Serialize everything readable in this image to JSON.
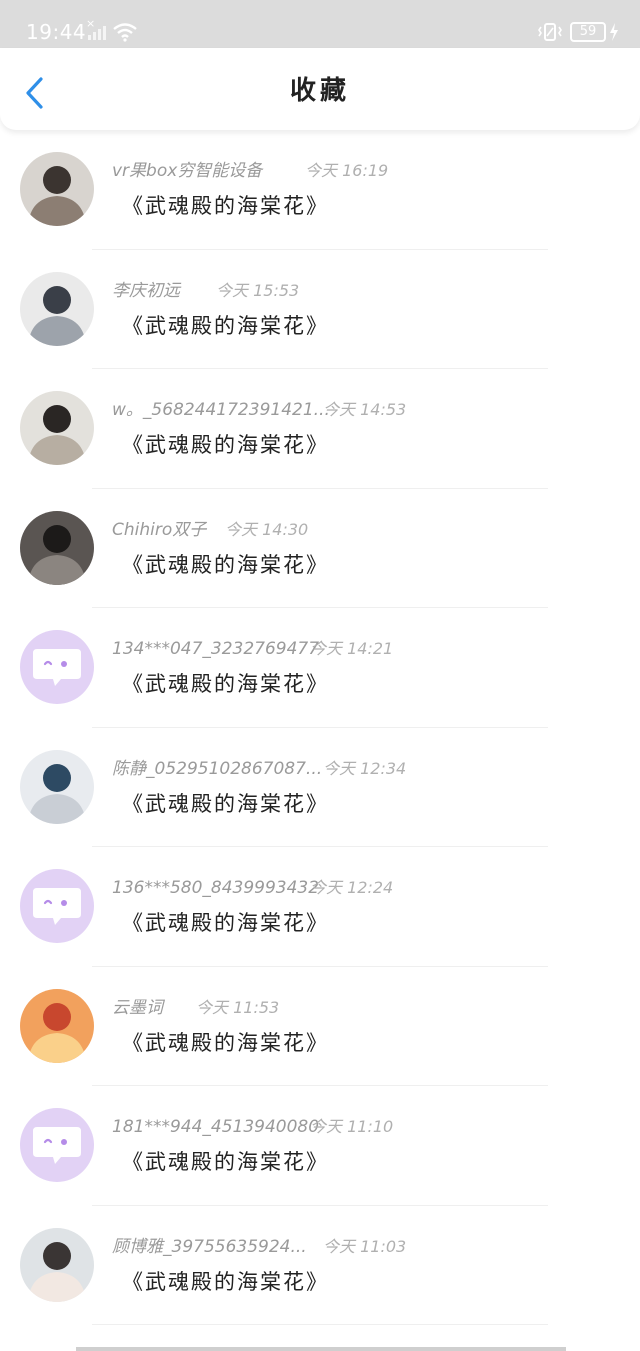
{
  "status_bar": {
    "time": "19:44",
    "battery": "59",
    "icons": [
      "signal-off-icon",
      "wifi-icon",
      "vibrate-icon",
      "battery-icon",
      "charging-icon"
    ]
  },
  "header": {
    "title": "收藏",
    "back_icon": "chevron-left-icon",
    "accent_color": "#2f8fe8"
  },
  "items": [
    {
      "username": "vr果box穷智能设备",
      "time": "今天 16:19",
      "title": "《武魂殿的海棠花》",
      "avatar": "photo"
    },
    {
      "username": "李庆初远",
      "time": "今天 15:53",
      "title": "《武魂殿的海棠花》",
      "avatar": "photo"
    },
    {
      "username": "w。_568244172391421...",
      "time": "今天 14:53",
      "title": "《武魂殿的海棠花》",
      "avatar": "photo"
    },
    {
      "username": "Chihiro双子",
      "time": "今天 14:30",
      "title": "《武魂殿的海棠花》",
      "avatar": "photo"
    },
    {
      "username": "134***047_3232769477",
      "time": "今天 14:21",
      "title": "《武魂殿的海棠花》",
      "avatar": "default"
    },
    {
      "username": "陈静_05295102867087...",
      "time": "今天 12:34",
      "title": "《武魂殿的海棠花》",
      "avatar": "photo"
    },
    {
      "username": "136***580_8439993432",
      "time": "今天 12:24",
      "title": "《武魂殿的海棠花》",
      "avatar": "default"
    },
    {
      "username": "云墨词",
      "time": "今天 11:53",
      "title": "《武魂殿的海棠花》",
      "avatar": "photo"
    },
    {
      "username": "181***944_4513940080",
      "time": "今天 11:10",
      "title": "《武魂殿的海棠花》",
      "avatar": "default"
    },
    {
      "username": "顾博雅_39755635924...",
      "time": "今天 11:03",
      "title": "《武魂殿的海棠花》",
      "avatar": "photo"
    }
  ],
  "colors": {
    "default_avatar_bg": "#e2d2f5",
    "default_avatar_fg": "#b58ce8"
  }
}
